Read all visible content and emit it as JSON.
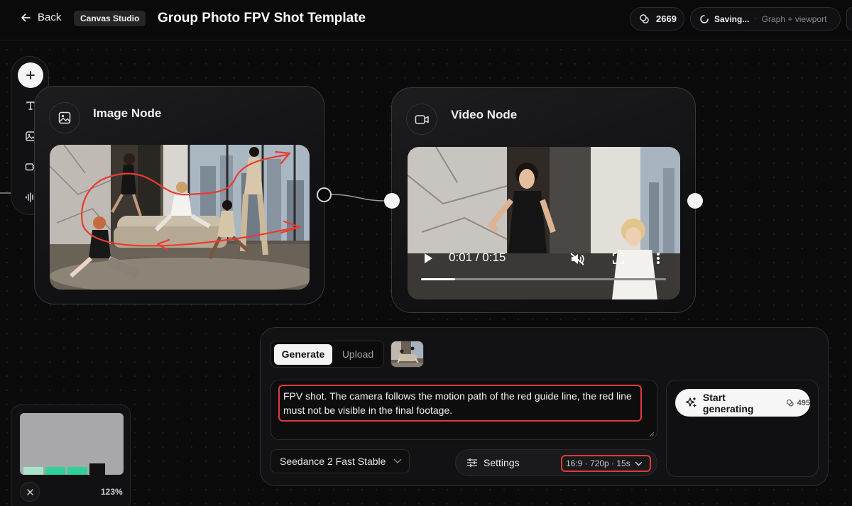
{
  "header": {
    "back_label": "Back",
    "studio_chip": "Canvas Studio",
    "title": "Group Photo FPV Shot Template",
    "credits": "2669",
    "saving_label": "Saving...",
    "saving_separator": "·",
    "saving_meta": "Graph + viewport"
  },
  "toolbar": {
    "items": [
      "add-icon",
      "text-icon",
      "image-icon",
      "video-icon",
      "audio-icon"
    ]
  },
  "image_node": {
    "title": "Image Node"
  },
  "video_node": {
    "title": "Video Node",
    "time_current": "0:01",
    "time_separator": "/",
    "time_total": "0:15",
    "progress": 0.14
  },
  "generate_panel": {
    "tab_generate": "Generate",
    "tab_upload": "Upload",
    "prompt": "FPV shot. The camera follows the motion path of the red guide line, the red line must not be visible in the final footage.",
    "model": "Seedance 2 Fast Stable",
    "settings_label": "Settings",
    "settings_summary": "16:9 · 720p · 15s",
    "start_label": "Start generating",
    "start_cost": "495"
  },
  "minimap": {
    "zoom": "123%"
  },
  "colors": {
    "background": "#0b0b0c",
    "annotation_red": "#e03a3a",
    "accent_white": "#f4f4f4",
    "minimap_green": "#2fd196"
  }
}
